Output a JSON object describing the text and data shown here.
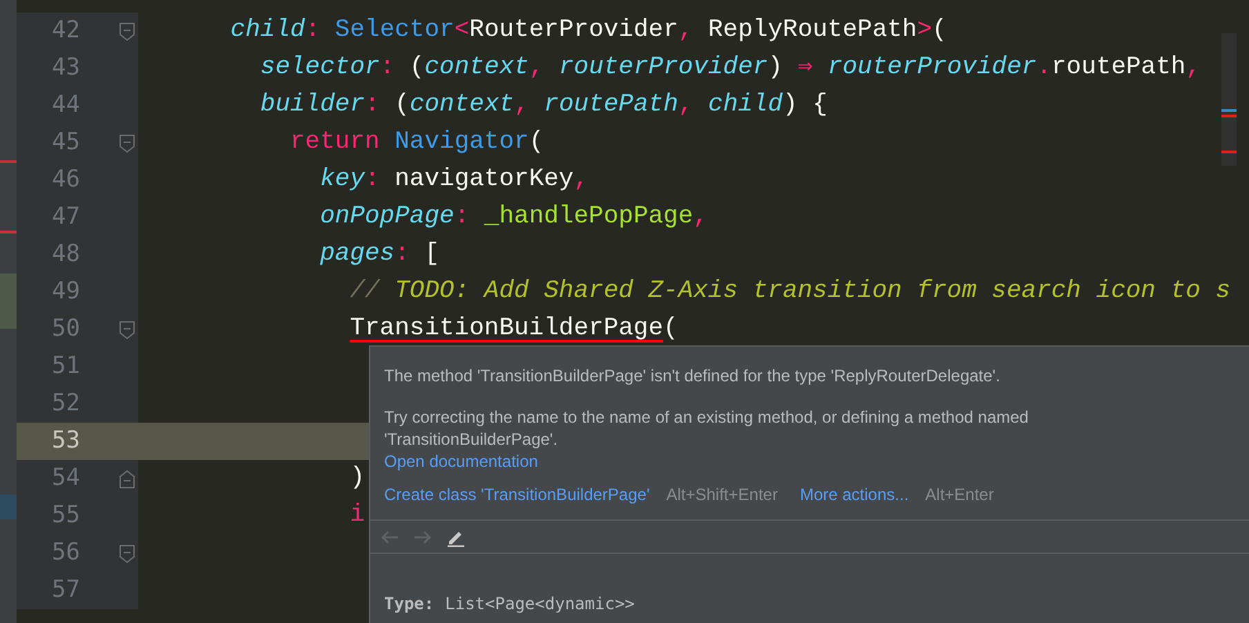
{
  "editor": {
    "lines": [
      {
        "number": "42",
        "fold_start": true,
        "fold_end": false,
        "current": false,
        "tokens": [
          {
            "kind": "prop",
            "text": "child"
          },
          {
            "kind": "punct",
            "text": ":"
          },
          {
            "kind": "type",
            "text": " Selector"
          },
          {
            "kind": "punct",
            "text": "<"
          },
          {
            "kind": "plain",
            "text": "RouterProvider"
          },
          {
            "kind": "punct",
            "text": ","
          },
          {
            "kind": "plain",
            "text": " ReplyRoutePath"
          },
          {
            "kind": "punct",
            "text": ">"
          },
          {
            "kind": "plain",
            "text": "("
          }
        ],
        "children": [
          {
            "number": "43",
            "fold_start": false,
            "fold_end": false,
            "current": false,
            "tokens": [
              {
                "kind": "prop",
                "text": "selector"
              },
              {
                "kind": "punct",
                "text": ":"
              },
              {
                "kind": "plain",
                "text": " ("
              },
              {
                "kind": "param",
                "text": "context"
              },
              {
                "kind": "punct",
                "text": ","
              },
              {
                "kind": "param",
                "text": " routerProvider"
              },
              {
                "kind": "plain",
                "text": ") "
              },
              {
                "kind": "punct",
                "text": "⇒"
              },
              {
                "kind": "param",
                "text": " routerProvider"
              },
              {
                "kind": "punct",
                "text": "."
              },
              {
                "kind": "plain",
                "text": "routePath"
              },
              {
                "kind": "punct",
                "text": ","
              }
            ]
          },
          {
            "number": "44",
            "fold_start": false,
            "fold_end": false,
            "current": false,
            "tokens": [
              {
                "kind": "prop",
                "text": "builder"
              },
              {
                "kind": "punct",
                "text": ":"
              },
              {
                "kind": "plain",
                "text": " ("
              },
              {
                "kind": "param",
                "text": "context"
              },
              {
                "kind": "punct",
                "text": ","
              },
              {
                "kind": "param",
                "text": " routePath"
              },
              {
                "kind": "punct",
                "text": ","
              },
              {
                "kind": "param",
                "text": " child"
              },
              {
                "kind": "plain",
                "text": ") {"
              }
            ],
            "children": [
              {
                "number": "45",
                "fold_start": true,
                "fold_end": false,
                "current": false,
                "tokens": [
                  {
                    "kind": "keyword",
                    "text": "return"
                  },
                  {
                    "kind": "type",
                    "text": " Navigator"
                  },
                  {
                    "kind": "plain",
                    "text": "("
                  }
                ],
                "children": [
                  {
                    "number": "46",
                    "fold_start": false,
                    "fold_end": false,
                    "current": false,
                    "tokens": [
                      {
                        "kind": "prop",
                        "text": "key"
                      },
                      {
                        "kind": "punct",
                        "text": ":"
                      },
                      {
                        "kind": "plain",
                        "text": " navigatorKey"
                      },
                      {
                        "kind": "punct",
                        "text": ","
                      }
                    ]
                  },
                  {
                    "number": "47",
                    "fold_start": false,
                    "fold_end": false,
                    "current": false,
                    "tokens": [
                      {
                        "kind": "prop",
                        "text": "onPopPage"
                      },
                      {
                        "kind": "punct",
                        "text": ":"
                      },
                      {
                        "kind": "func",
                        "text": " _handlePopPage"
                      },
                      {
                        "kind": "punct",
                        "text": ","
                      }
                    ]
                  },
                  {
                    "number": "48",
                    "fold_start": false,
                    "fold_end": false,
                    "current": false,
                    "tokens": [
                      {
                        "kind": "prop",
                        "text": "pages"
                      },
                      {
                        "kind": "punct",
                        "text": ":"
                      },
                      {
                        "kind": "plain",
                        "text": " ["
                      }
                    ],
                    "children": [
                      {
                        "number": "49",
                        "fold_start": false,
                        "fold_end": false,
                        "current": false,
                        "tokens": [
                          {
                            "kind": "slash",
                            "text": "//"
                          },
                          {
                            "kind": "comment",
                            "text": " TODO: Add Shared Z-Axis transition from search icon to s"
                          }
                        ]
                      },
                      {
                        "number": "50",
                        "fold_start": true,
                        "fold_end": false,
                        "current": false,
                        "tokens": [
                          {
                            "kind": "error",
                            "text": "TransitionBuilderPage"
                          },
                          {
                            "kind": "plain",
                            "text": "("
                          }
                        ]
                      },
                      {
                        "number": "51",
                        "fold_start": false,
                        "fold_end": false,
                        "current": false
                      },
                      {
                        "number": "52",
                        "fold_start": false,
                        "fold_end": false,
                        "current": false
                      },
                      {
                        "number": "53",
                        "fold_start": false,
                        "fold_end": false,
                        "current": true
                      },
                      {
                        "number": "54",
                        "fold_start": false,
                        "fold_end": true,
                        "current": false,
                        "tokens": [
                          {
                            "kind": "plain",
                            "text": ")"
                          }
                        ]
                      },
                      {
                        "number": "55",
                        "fold_start": false,
                        "fold_end": false,
                        "current": false,
                        "tokens": [
                          {
                            "kind": "keyword",
                            "text": "i"
                          }
                        ]
                      }
                    ]
                  }
                ]
              }
            ]
          }
        ]
      },
      {
        "number": "56",
        "fold_start": true,
        "fold_end": false,
        "current": false
      },
      {
        "number": "57",
        "fold_start": false,
        "fold_end": false,
        "current": false
      }
    ]
  },
  "popup": {
    "message": "The method 'TransitionBuilderPage' isn't defined for the type 'ReplyRouterDelegate'.",
    "hint": "Try correcting the name to the name of an existing method, or defining a method named 'TransitionBuilderPage'.",
    "doc_link": "Open documentation",
    "actions": [
      {
        "label": "Create class 'TransitionBuilderPage'",
        "shortcut": "Alt+Shift+Enter"
      },
      {
        "label": "More actions...",
        "shortcut": "Alt+Enter"
      }
    ],
    "nav": [
      {
        "kind": "back",
        "disabled": true
      },
      {
        "kind": "forward",
        "disabled": true
      },
      {
        "kind": "edit",
        "disabled": false
      }
    ],
    "type_label": "Type:",
    "type_value": "List<Page<dynamic>>"
  }
}
